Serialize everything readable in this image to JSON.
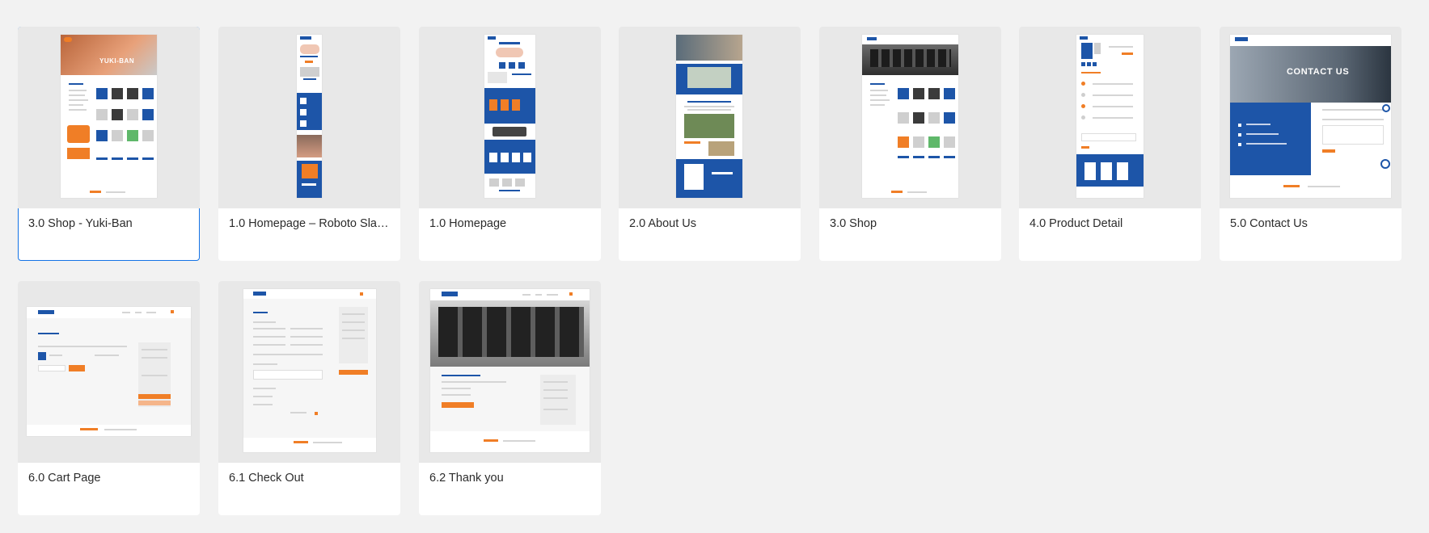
{
  "artboards": [
    {
      "label": "3.0 Shop - Yuki-Ban",
      "selected": true,
      "thumb_text": "YUKI-BAN"
    },
    {
      "label": "1.0 Homepage – Roboto Slab..."
    },
    {
      "label": "1.0 Homepage"
    },
    {
      "label": "2.0 About Us"
    },
    {
      "label": "3.0 Shop"
    },
    {
      "label": "4.0 Product Detail"
    },
    {
      "label": "5.0 Contact Us",
      "thumb_text": "CONTACT US"
    },
    {
      "label": "6.0 Cart Page"
    },
    {
      "label": "6.1 Check Out"
    },
    {
      "label": "6.2 Thank you"
    }
  ],
  "colors": {
    "brand_blue": "#1d55a8",
    "brand_orange": "#f07e26",
    "selection": "#1473e6",
    "background": "#f2f2f2"
  }
}
